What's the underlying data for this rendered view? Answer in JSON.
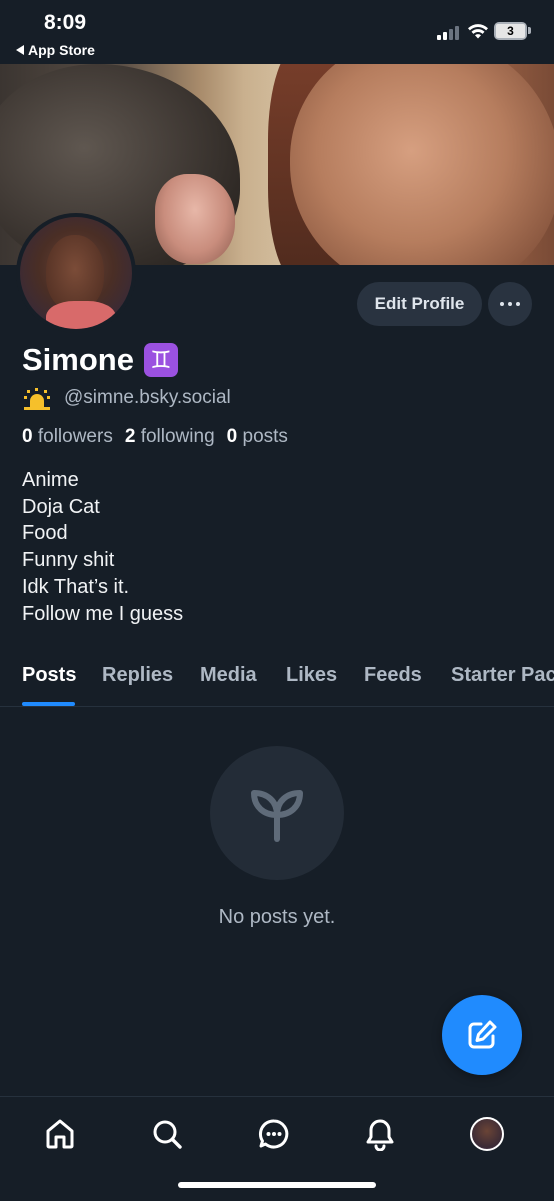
{
  "status_bar": {
    "time": "8:09",
    "back_label": "App Store",
    "battery": "3"
  },
  "profile": {
    "edit_label": "Edit Profile",
    "display_name": "Simone",
    "zodiac_emoji": "♊",
    "handle": "@simne.bsky.social",
    "followers_count": "0",
    "followers_label": "followers",
    "following_count": "2",
    "following_label": "following",
    "posts_count": "0",
    "posts_label": "posts",
    "bio_lines": [
      "Anime",
      "Doja Cat",
      "Food",
      "Funny shit",
      "Idk That’s it.",
      "Follow me I guess"
    ]
  },
  "tabs": [
    {
      "label": "Posts",
      "active": true
    },
    {
      "label": "Replies"
    },
    {
      "label": "Media"
    },
    {
      "label": "Likes"
    },
    {
      "label": "Feeds"
    },
    {
      "label": "Starter Pac"
    }
  ],
  "feed": {
    "empty_text": "No posts yet."
  },
  "icons": {
    "sunrise": "sunrise-icon",
    "empty": "sprout-icon",
    "compose": "compose-icon",
    "nav": [
      "home-icon",
      "search-icon",
      "chat-icon",
      "bell-icon",
      "profile-avatar"
    ]
  },
  "colors": {
    "background": "#161e27",
    "accent": "#208bfe",
    "button_bg": "#293340",
    "muted_text": "#aeb8c4"
  }
}
